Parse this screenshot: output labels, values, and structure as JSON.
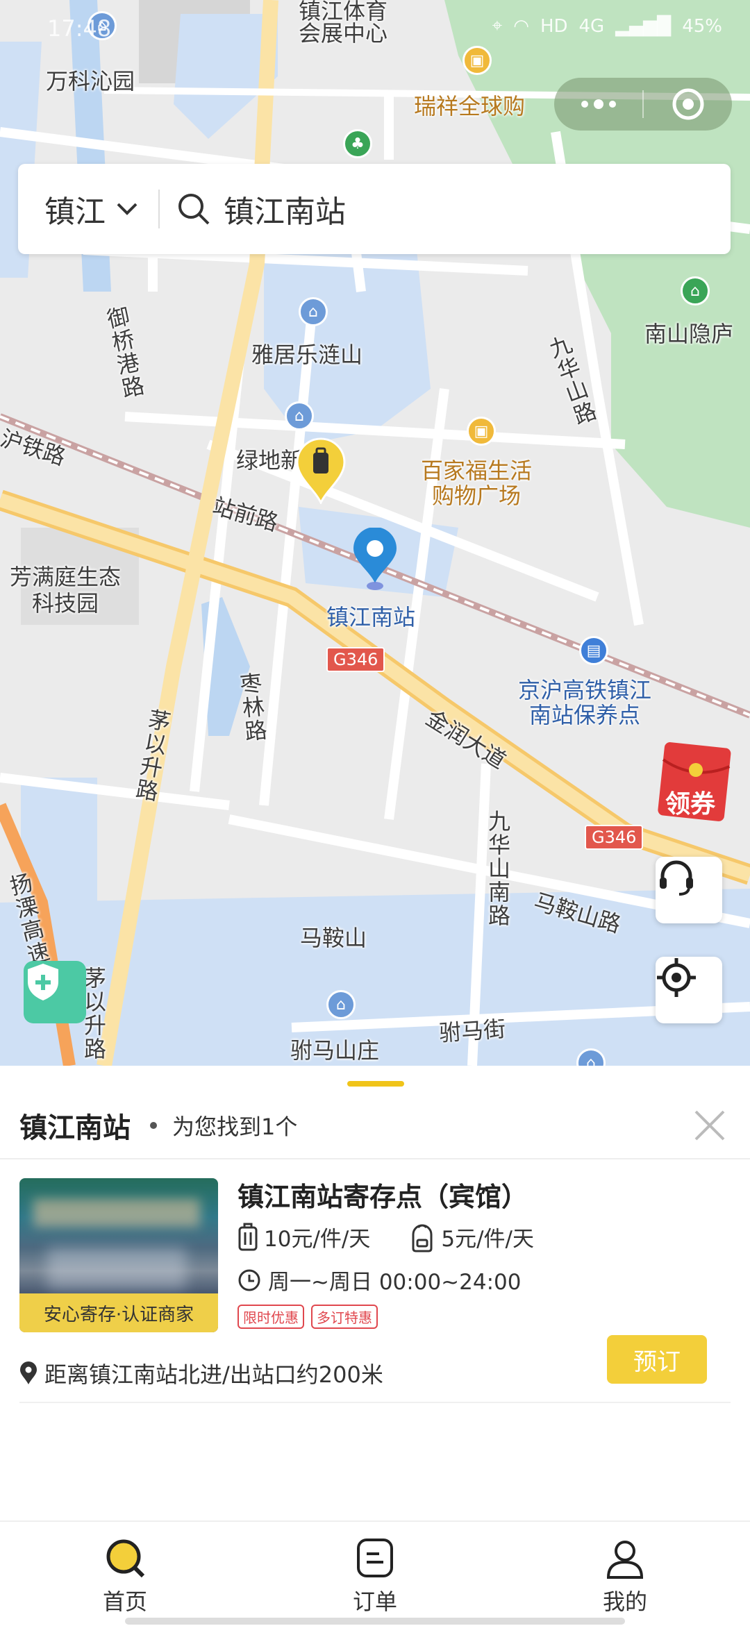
{
  "status_bar": {
    "time": "17:48",
    "hd": "HD",
    "network": "4G",
    "battery": "45%"
  },
  "search": {
    "city": "镇江",
    "query": "镇江南站"
  },
  "map_labels": {
    "wanke": "万科沁园",
    "tiyu": "镇江体育\n会展中心",
    "ruixiang": "瑞祥全球购",
    "nanshan": "南山隐庐",
    "yaju": "雅居乐涟山",
    "lvdi": "绿地新城",
    "baijiafu": "百家福生活\n购物广场",
    "zhanqian": "站前路",
    "station": "镇江南站",
    "fangman": "芳满庭生态\n科技园",
    "gaotie": "京沪高铁镇江\n南站保养点",
    "g346a": "G346",
    "g346b": "G346",
    "jinrun": "金润大道",
    "maan": "马鞍山",
    "maanshanlu": "马鞍山路",
    "jiuhuashan_nan": "九华山南路",
    "jiuhuashan": "九华山路",
    "yuqiaogang": "御桥港路",
    "maoyisheng": "茅以升路",
    "maoyisheng2": "茅以升路",
    "zaolin": "枣林路",
    "yangli": "扬溧高速",
    "tielu": "沪铁路",
    "fumajie": "驸马街",
    "fumashanzhuang": "驸马山庄"
  },
  "coupon_label": "领券",
  "result": {
    "title": "镇江南站",
    "found_text": "为您找到1个",
    "store": {
      "name": "镇江南站寄存点（宾馆）",
      "tag": "安心寄存·认证商家",
      "price_luggage": "10元/件/天",
      "price_bag": "5元/件/天",
      "hours": "周一~周日 00:00~24:00",
      "badges": [
        "限时优惠",
        "多订特惠"
      ],
      "distance": "距离镇江南站北进/出站口约200米",
      "book_label": "预订"
    }
  },
  "tabs": [
    {
      "label": "首页",
      "icon": "home-search-icon"
    },
    {
      "label": "订单",
      "icon": "order-icon"
    },
    {
      "label": "我的",
      "icon": "user-icon"
    }
  ],
  "colors": {
    "accent": "#F3CF3A",
    "pin": "#2A8BD8",
    "badge_red": "#E0474E",
    "shield": "#4CC9A4"
  }
}
